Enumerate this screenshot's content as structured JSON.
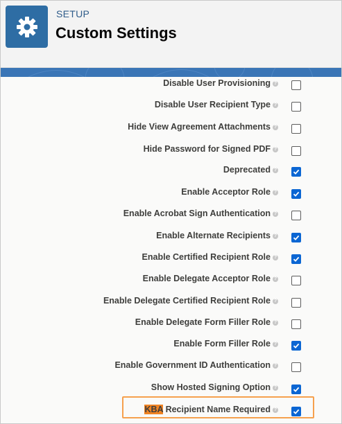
{
  "header": {
    "section": "SETUP",
    "title": "Custom Settings"
  },
  "settings": [
    {
      "label": "Disable User Provisioning",
      "checked": false
    },
    {
      "label": "Disable User Recipient Type",
      "checked": false
    },
    {
      "label": "Hide View Agreement Attachments",
      "checked": false
    },
    {
      "label": "Hide Password for Signed PDF",
      "checked": false
    },
    {
      "label": "Deprecated",
      "checked": true
    },
    {
      "label": "Enable Acceptor Role",
      "checked": true
    },
    {
      "label": "Enable Acrobat Sign Authentication",
      "checked": false
    },
    {
      "label": "Enable Alternate Recipients",
      "checked": true
    },
    {
      "label": "Enable Certified Recipient Role",
      "checked": true
    },
    {
      "label": "Enable Delegate Acceptor Role",
      "checked": false
    },
    {
      "label": "Enable Delegate Certified Recipient Role",
      "checked": false
    },
    {
      "label": "Enable Delegate Form Filler Role",
      "checked": false
    },
    {
      "label": "Enable Form Filler Role",
      "checked": true
    },
    {
      "label": "Enable Government ID Authentication",
      "checked": false
    },
    {
      "label": "Show Hosted Signing Option",
      "checked": true
    },
    {
      "label_highlight": "KBA",
      "label_rest": " Recipient Name Required",
      "checked": true
    }
  ],
  "colors": {
    "accent": "#2e6da4",
    "checkbox_checked": "#0b66d3",
    "highlight_outline": "#f6a04d",
    "highlight_mark": "#f08323"
  },
  "icons": {
    "app": "gear-icon",
    "help": "info-icon",
    "check": "checkmark-icon"
  }
}
